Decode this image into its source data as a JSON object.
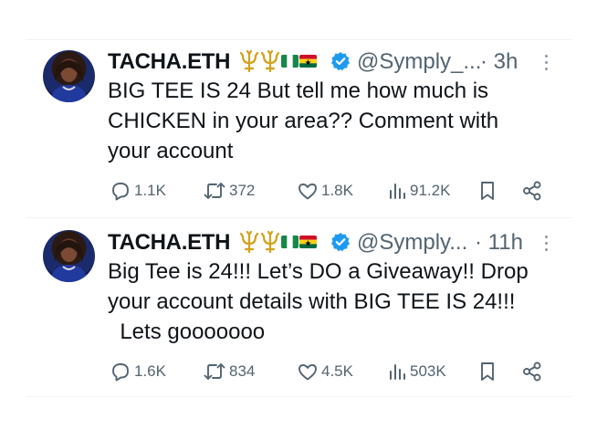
{
  "tweets": [
    {
      "author": "TACHA.ETH",
      "handle": "@Symply_...",
      "time": "· 3h",
      "lines": [
        "BIG TEE IS 24 But tell me how much is",
        "CHICKEN in your area?? Comment with",
        "your account"
      ],
      "replies": "1.1K",
      "reposts": "372",
      "likes": "1.8K",
      "views": "91.2K"
    },
    {
      "author": "TACHA.ETH",
      "handle": "@Symply...",
      "time": "· 11h",
      "lines": [
        "Big Tee is 24!!! Let’s DO a Giveaway!! Drop",
        "your account details with BIG TEE IS 24!!!",
        "  Lets gooooooo"
      ],
      "replies": "1.6K",
      "reposts": "834",
      "likes": "4.5K",
      "views": "503K"
    }
  ],
  "icons": {
    "verified": "verified-badge-icon",
    "reply": "reply-icon",
    "repost": "repost-icon",
    "like": "heart-icon",
    "views": "views-icon",
    "bookmark": "bookmark-icon",
    "share": "share-icon",
    "more": "more-options-icon"
  },
  "colors": {
    "verified": "#1d9bf0",
    "muted": "#536471",
    "text": "#0f1419"
  }
}
